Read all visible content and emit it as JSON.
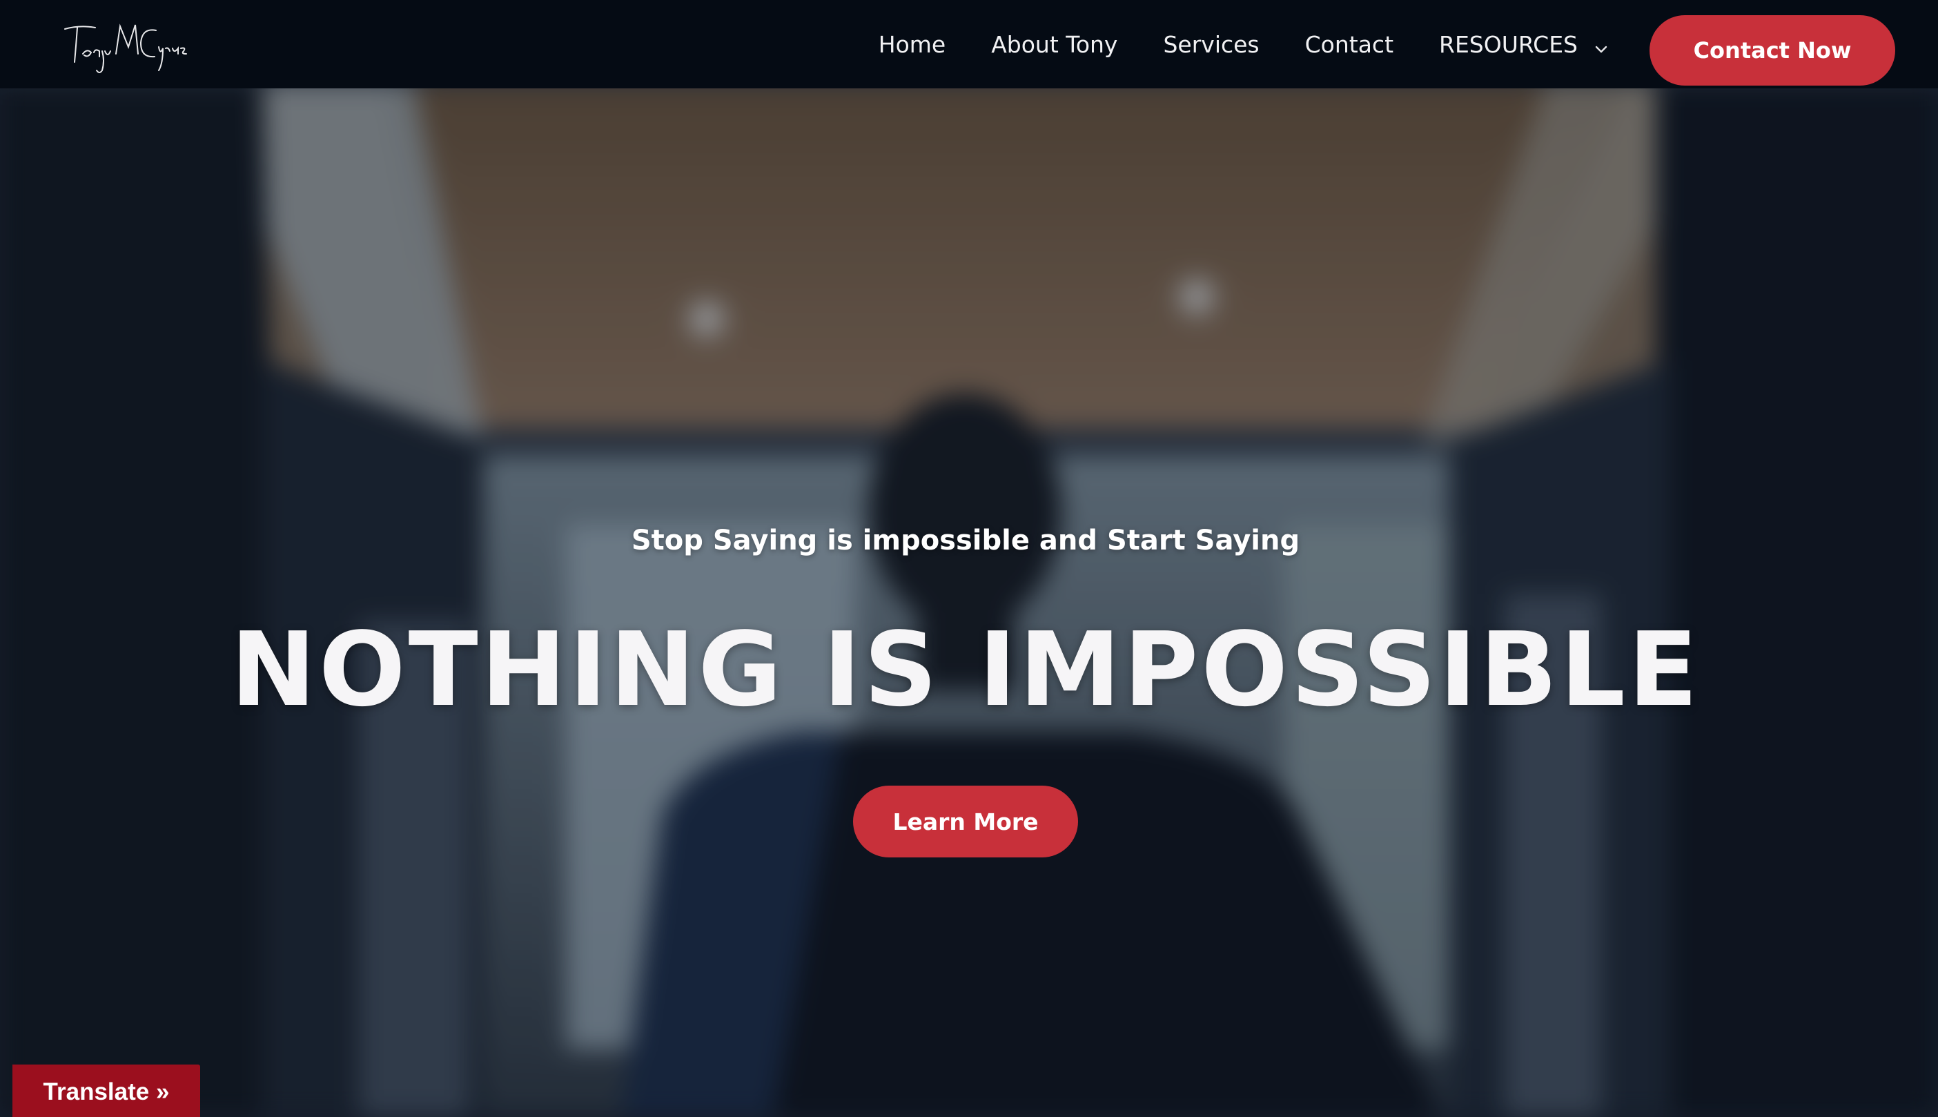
{
  "header": {
    "logo_text": "Tony M Cyrus",
    "nav": [
      {
        "label": "Home"
      },
      {
        "label": "About Tony"
      },
      {
        "label": "Services"
      },
      {
        "label": "Contact"
      },
      {
        "label": "RESOURCES",
        "has_dropdown": true
      }
    ],
    "cta_label": "Contact Now"
  },
  "hero": {
    "subtitle": "Stop Saying is impossible and Start Saying",
    "title": "NOTHING IS IMPOSSIBLE",
    "button_label": "Learn More"
  },
  "translate": {
    "label": "Translate »"
  },
  "colors": {
    "accent": "#c8303a",
    "header_bg": "#050b14",
    "translate_bg": "#9b0f1e"
  }
}
